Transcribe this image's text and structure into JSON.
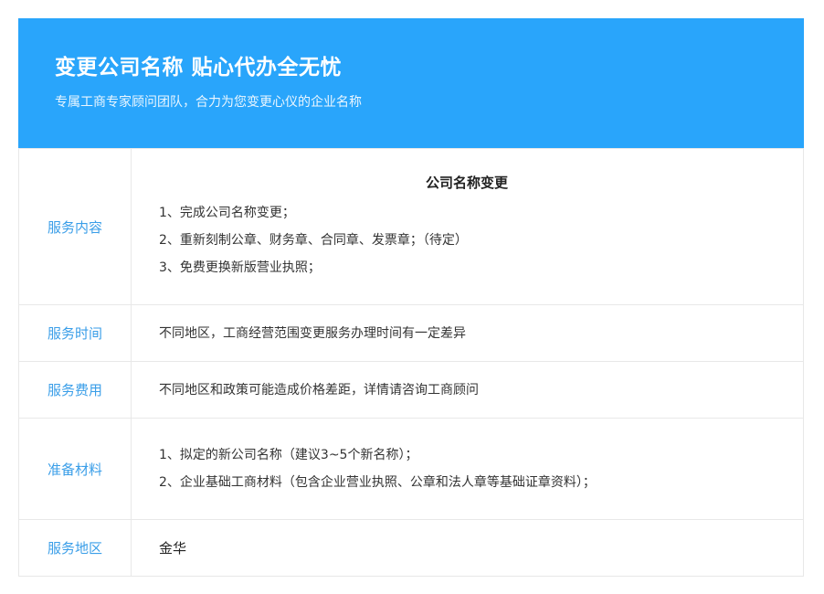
{
  "banner": {
    "title": "变更公司名称 贴心代办全无忧",
    "subtitle": "专属工商专家顾问团队，合力为您变更心仪的企业名称"
  },
  "rows": {
    "content": {
      "label": "服务内容",
      "heading": "公司名称变更",
      "items": [
        "1、完成公司名称变更；",
        "2、重新刻制公章、财务章、合同章、发票章；（待定）",
        "3、免费更换新版营业执照；"
      ]
    },
    "time": {
      "label": "服务时间",
      "value": "不同地区，工商经营范围变更服务办理时间有一定差异"
    },
    "fee": {
      "label": "服务费用",
      "value": "不同地区和政策可能造成价格差距，详情请咨询工商顾问"
    },
    "material": {
      "label": "准备材料",
      "items": [
        "1、拟定的新公司名称（建议3~5个新名称）；",
        "2、企业基础工商材料（包含企业营业执照、公章和法人章等基础证章资料）；"
      ]
    },
    "area": {
      "label": "服务地区",
      "value": "金华"
    }
  },
  "colors": {
    "banner_bg": "#29a5fb",
    "label_text": "#3a9ee8",
    "border": "#e8e8e8"
  }
}
